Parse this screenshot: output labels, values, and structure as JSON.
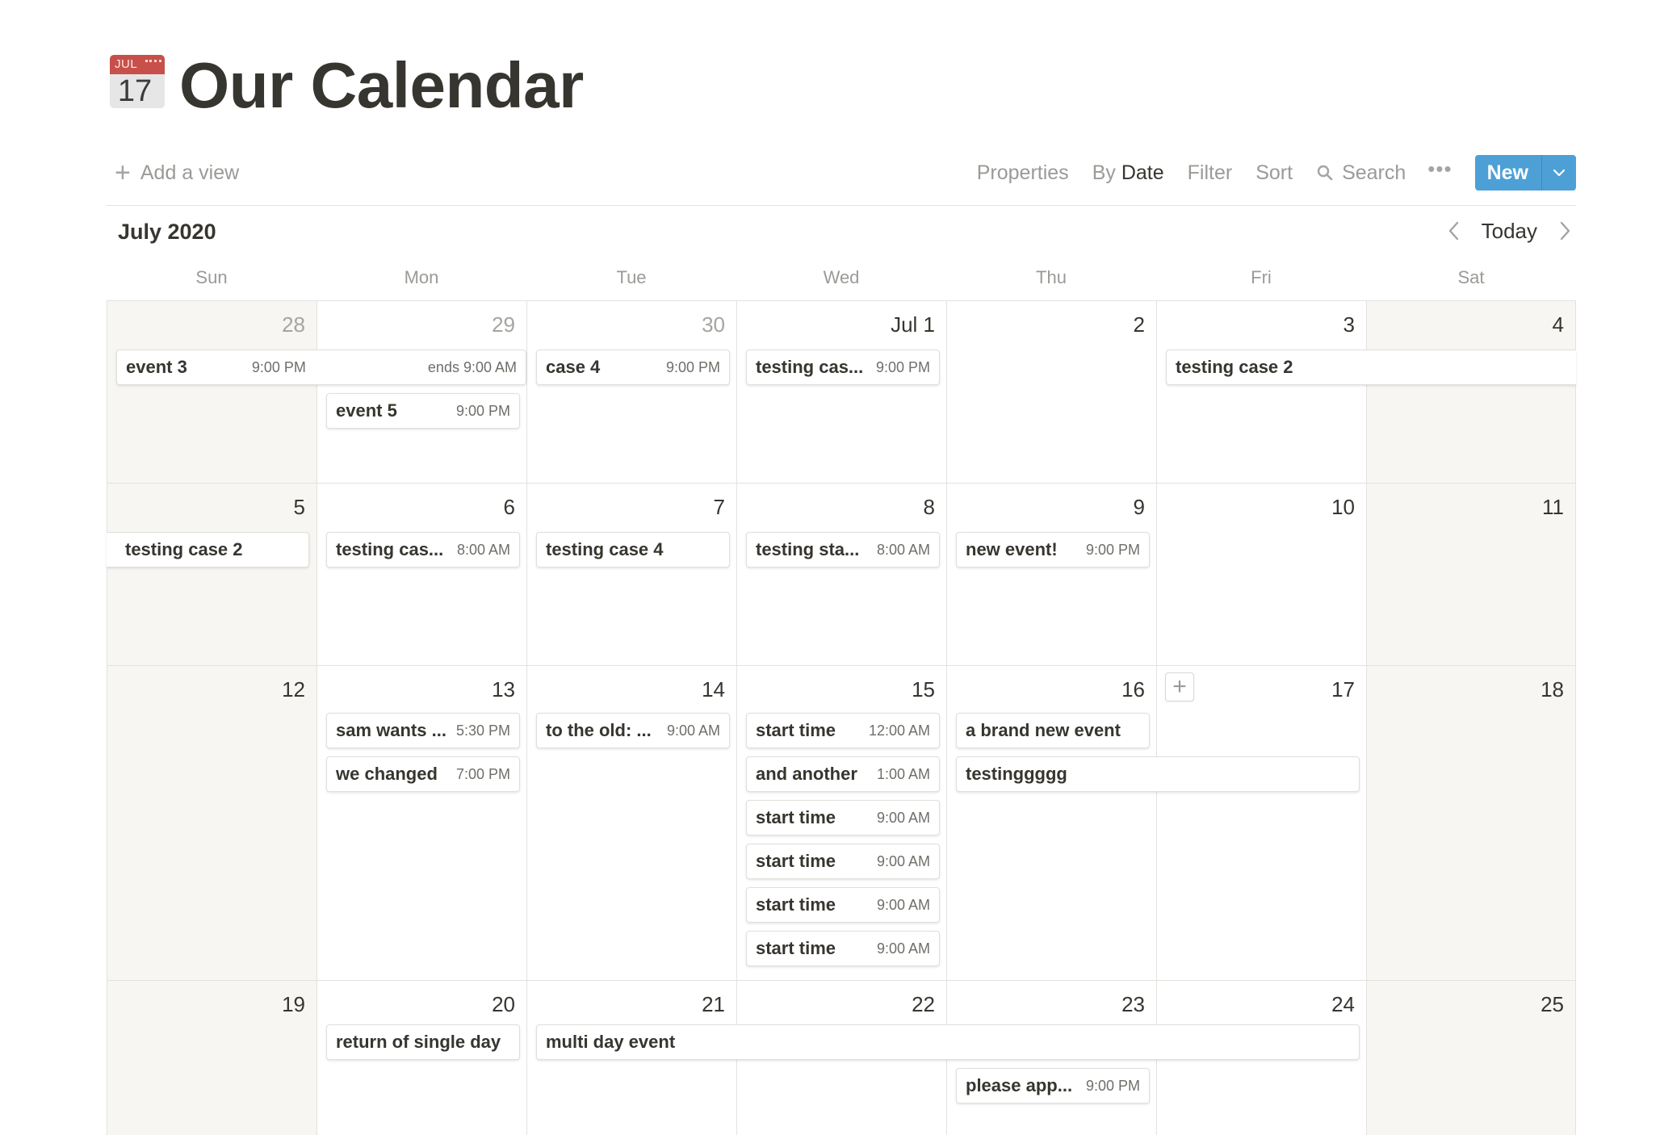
{
  "page": {
    "icon_month": "JUL",
    "icon_day": "17",
    "title": "Our Calendar"
  },
  "toolbar": {
    "add_view": "Add a view",
    "properties": "Properties",
    "by_prefix": "By",
    "by_value": "Date",
    "filter": "Filter",
    "sort": "Sort",
    "search": "Search",
    "more": "•••",
    "new_label": "New"
  },
  "colors": {
    "accent": "#4da0d6",
    "weekend_bg": "#f7f6f3",
    "text": "#37352f",
    "muted": "#9b9a97"
  },
  "calendar": {
    "month_label": "July 2020",
    "today_label": "Today",
    "weekdays": [
      "Sun",
      "Mon",
      "Tue",
      "Wed",
      "Thu",
      "Fri",
      "Sat"
    ],
    "weeks": [
      [
        "28",
        "29",
        "30",
        "Jul 1",
        "2",
        "3",
        "4"
      ],
      [
        "5",
        "6",
        "7",
        "8",
        "9",
        "10",
        "11"
      ],
      [
        "12",
        "13",
        "14",
        "15",
        "16",
        "17",
        "18"
      ],
      [
        "19",
        "20",
        "21",
        "22",
        "23",
        "24",
        "25"
      ]
    ]
  },
  "events": {
    "e1": {
      "title": "event 3",
      "time": "9:00 PM",
      "end": "ends 9:00 AM"
    },
    "e2": {
      "title": "event 5",
      "time": "9:00 PM"
    },
    "e3": {
      "title": "case 4",
      "time": "9:00 PM"
    },
    "e4": {
      "title": "testing cas...",
      "time": "9:00 PM"
    },
    "e5": {
      "title": "testing case 2"
    },
    "e6": {
      "title": "testing case 2"
    },
    "e7": {
      "title": "testing cas...",
      "time": "8:00 AM"
    },
    "e8": {
      "title": "testing case 4"
    },
    "e9": {
      "title": "testing sta...",
      "time": "8:00 AM"
    },
    "e10": {
      "title": "new event!",
      "time": "9:00 PM"
    },
    "e11": {
      "title": "sam wants ...",
      "time": "5:30 PM"
    },
    "e12": {
      "title": "we changed",
      "time": "7:00 PM"
    },
    "e13": {
      "title": "to the old: ...",
      "time": "9:00 AM"
    },
    "e14": {
      "title": "start time",
      "time": "12:00 AM"
    },
    "e15": {
      "title": "and another",
      "time": "1:00 AM"
    },
    "e16": {
      "title": "start time",
      "time": "9:00 AM"
    },
    "e17": {
      "title": "start time",
      "time": "9:00 AM"
    },
    "e18": {
      "title": "start time",
      "time": "9:00 AM"
    },
    "e19": {
      "title": "start time",
      "time": "9:00 AM"
    },
    "e20": {
      "title": "a brand new event"
    },
    "e21": {
      "title": "testinggggg"
    },
    "e22": {
      "title": "return of single day"
    },
    "e23": {
      "title": "multi day event"
    },
    "e24": {
      "title": "please app...",
      "time": "9:00 PM"
    }
  }
}
